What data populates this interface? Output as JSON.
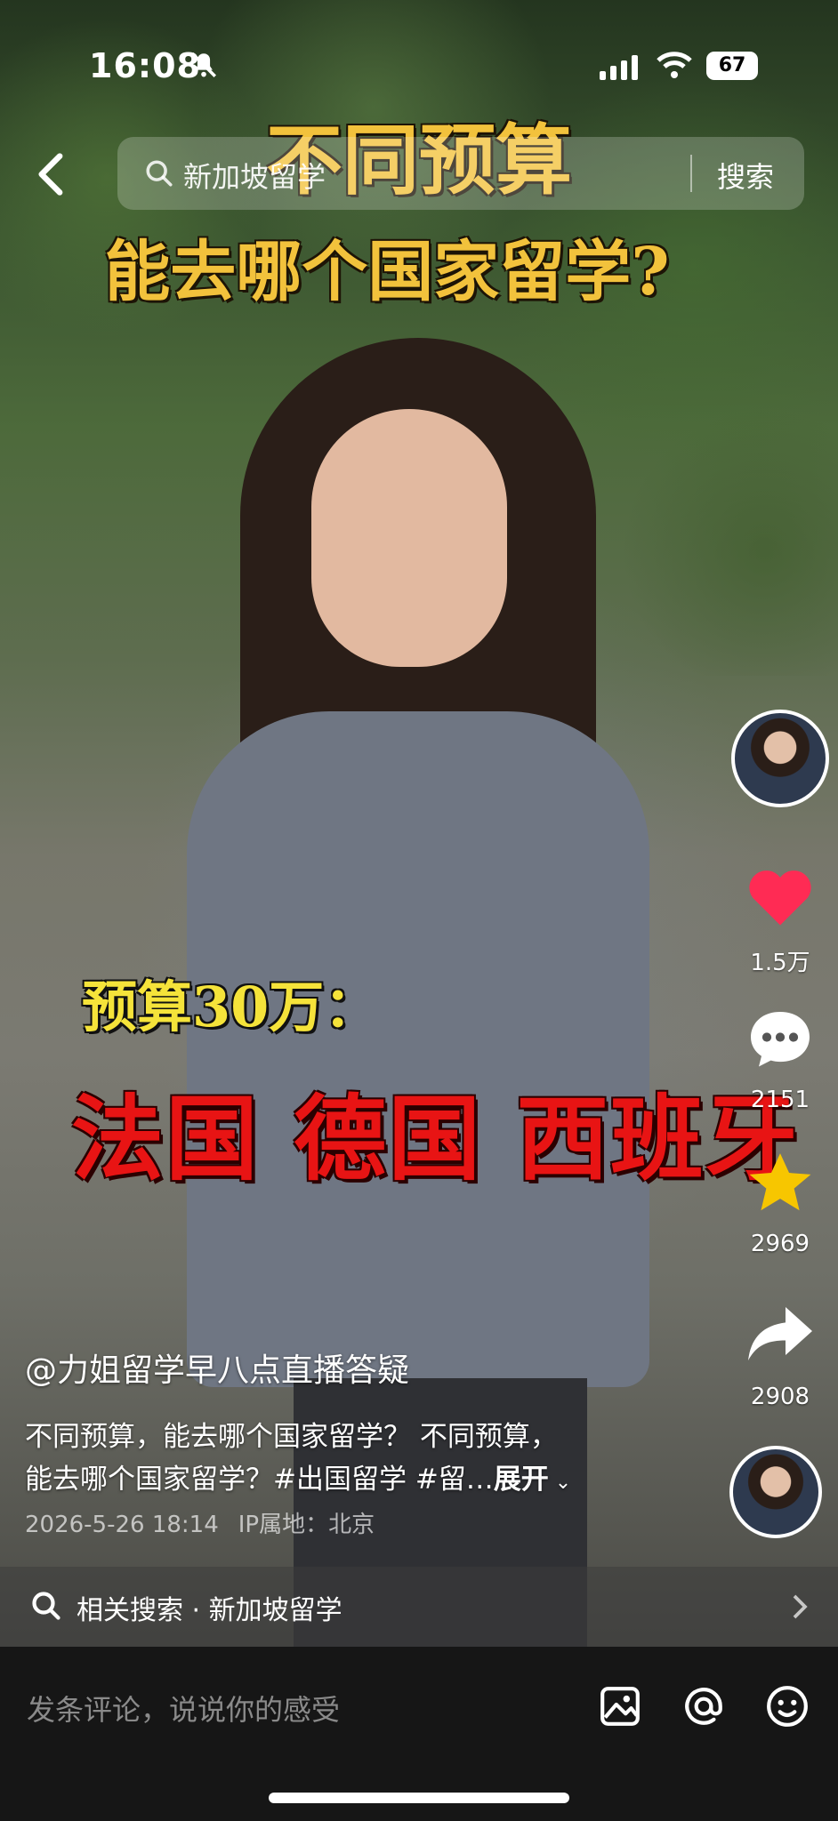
{
  "status": {
    "time": "16:08",
    "battery": "67",
    "icons": [
      "bell-off-icon",
      "signal-icon",
      "wifi-icon",
      "battery-icon"
    ]
  },
  "nav": {
    "search_text": "新加坡留学",
    "search_button": "搜索",
    "icons": [
      "back-icon",
      "search-icon"
    ]
  },
  "video": {
    "title_line1": "不同预算",
    "title_line2": "能去哪个国家留学?",
    "budget_label": "预算30万：",
    "countries": "法国 德国 西班牙"
  },
  "actions": {
    "likes": "1.5万",
    "comments": "2151",
    "favorites": "2969",
    "shares": "2908",
    "icons": [
      "heart-icon",
      "comment-icon",
      "star-icon",
      "share-icon"
    ],
    "like_color": "#ff2b54",
    "star_color": "#f7c600"
  },
  "info": {
    "author": "@力姐留学早八点直播答疑",
    "desc_line1": "不同预算，能去哪个国家留学？ 不同预算，",
    "desc_line2": "能去哪个国家留学？#出国留学 #留…",
    "expand": "展开",
    "date": "2026-5-26 18:14",
    "ip": "IP属地：北京"
  },
  "related": {
    "text": "相关搜索 · 新加坡留学"
  },
  "comment": {
    "placeholder": "发条评论，说说你的感受",
    "icons": [
      "image-icon",
      "at-icon",
      "emoji-icon"
    ]
  }
}
